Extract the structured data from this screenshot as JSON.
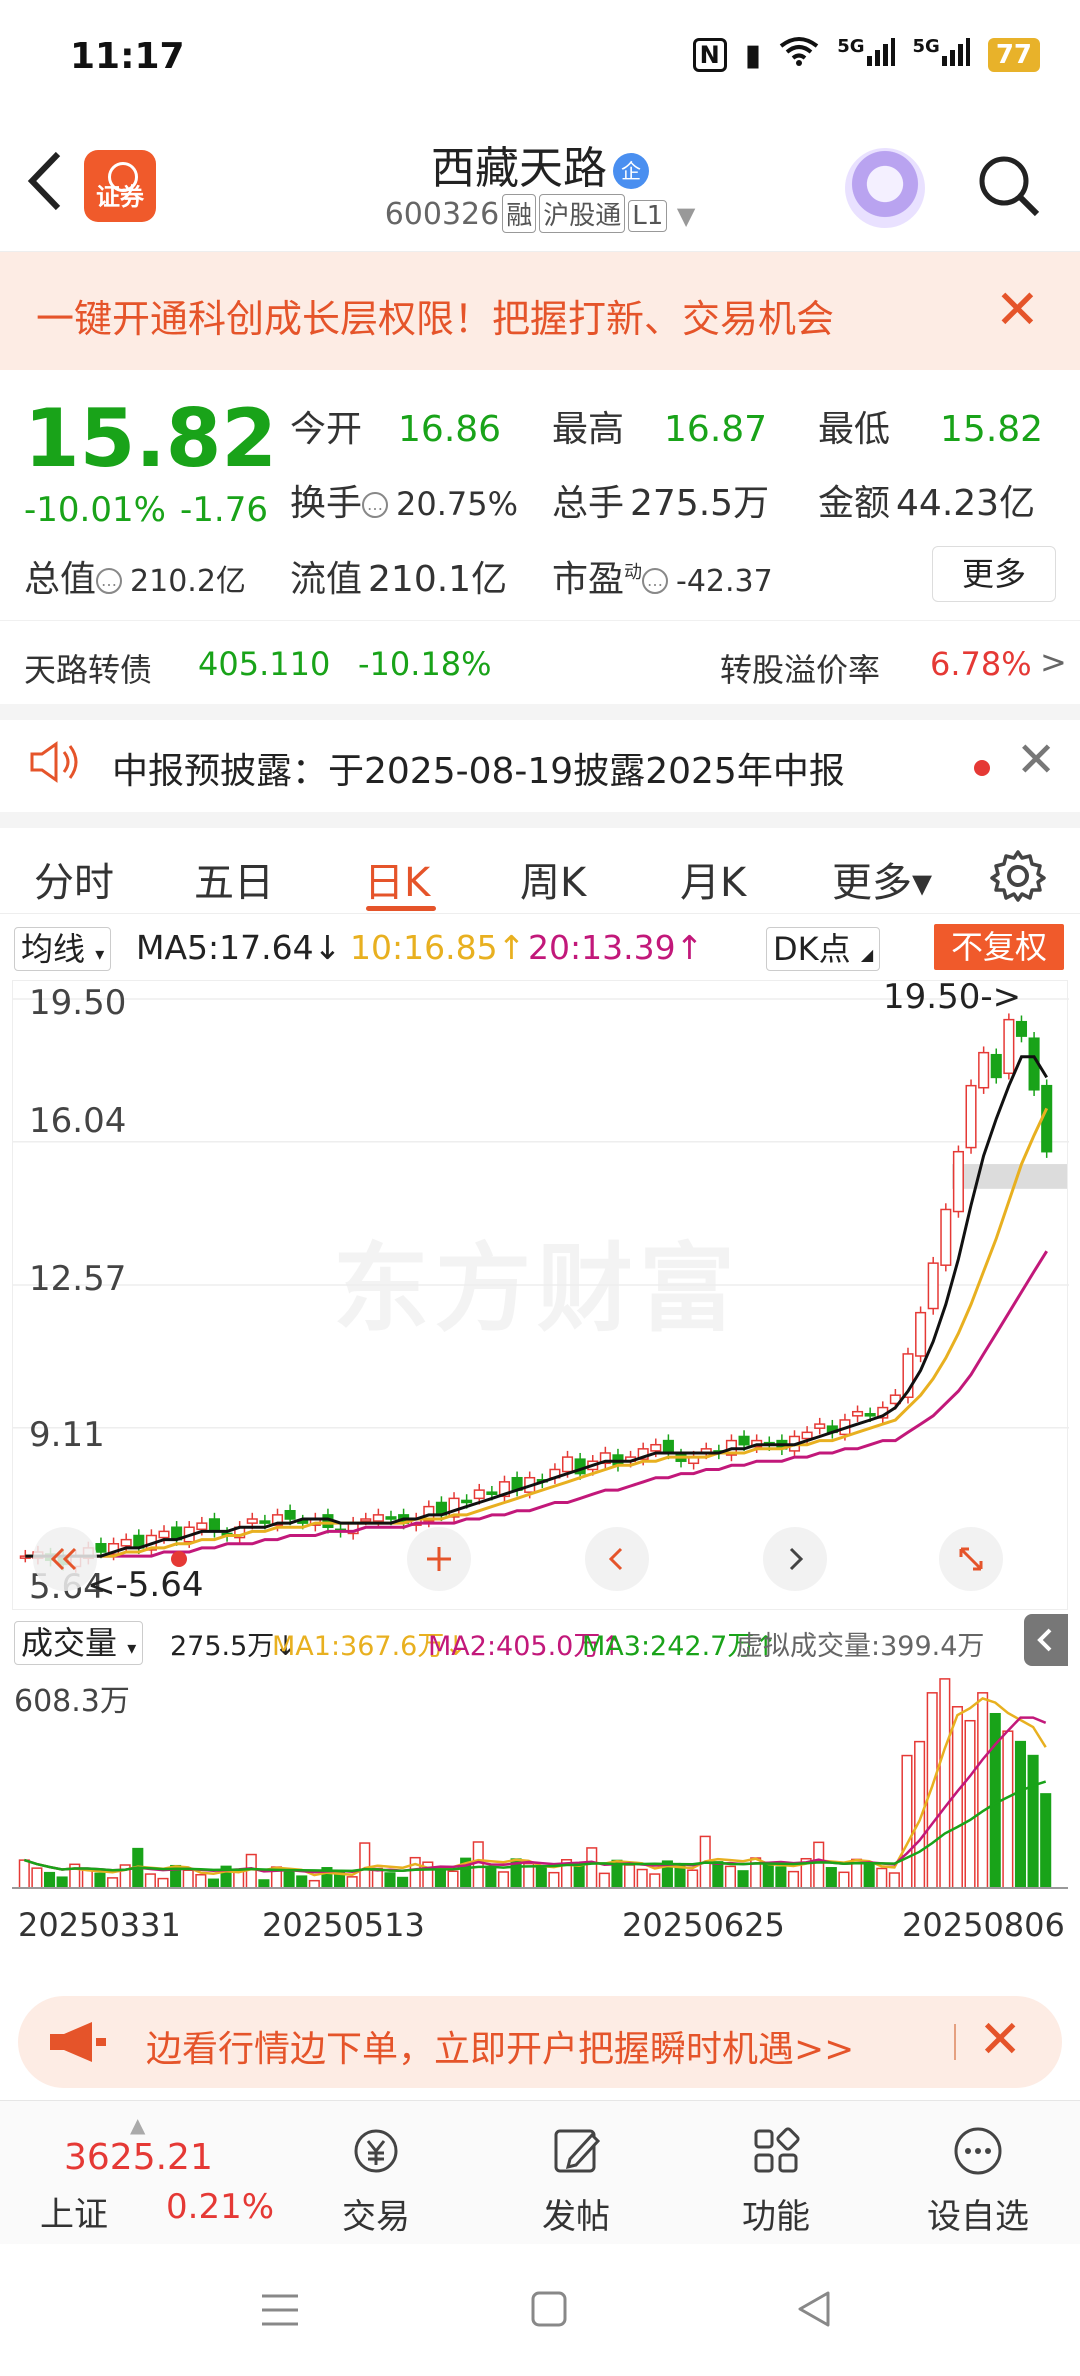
{
  "status": {
    "time": "11:17",
    "nfc": "N",
    "net1": "5G",
    "net2": "5G",
    "battery": "77"
  },
  "header": {
    "broker_label": "证券",
    "stock_name": "西藏天路",
    "badge": "企",
    "code": "600326",
    "tags": [
      "融",
      "沪股通",
      "L1"
    ]
  },
  "promo": {
    "text": "一键开通科创成长层权限！把握打新、交易机会",
    "close": "✕"
  },
  "quote": {
    "price": "15.82",
    "pct": "-10.01%",
    "chg": "-1.76",
    "open_label": "今开",
    "open": "16.86",
    "high_label": "最高",
    "high": "16.87",
    "low_label": "最低",
    "low": "15.82",
    "turnover_label": "换手",
    "turnover": "20.75%",
    "volume_label": "总手",
    "volume": "275.5万",
    "amount_label": "金额",
    "amount": "44.23亿",
    "mktcap_label": "总值",
    "mktcap": "210.2亿",
    "float_label": "流值",
    "float": "210.1亿",
    "pe_label": "市盈",
    "pe_sup": "动",
    "pe": "-42.37",
    "more": "更多"
  },
  "bond": {
    "name": "天路转债",
    "price": "405.110",
    "pct": "-10.18%",
    "premium_label": "转股溢价率",
    "premium": "6.78%",
    "arrow": ">"
  },
  "notice": {
    "text": "中报预披露：于2025-08-19披露2025年中报",
    "close": "✕"
  },
  "tabs": [
    {
      "label": "分时"
    },
    {
      "label": "五日"
    },
    {
      "label": "日K"
    },
    {
      "label": "周K"
    },
    {
      "label": "月K"
    },
    {
      "label": "更多▾"
    }
  ],
  "chart_head": {
    "indicator": "均线",
    "ma5": "MA5:17.64↓",
    "ma10": "10:16.85↑",
    "ma20": "20:13.39↑",
    "dk": "DK点",
    "fq": "不复权"
  },
  "chart_data": {
    "type": "candlestick",
    "y_ticks": [
      "19.50",
      "16.04",
      "12.57",
      "9.11",
      "5.64"
    ],
    "ylim": [
      5.64,
      19.5
    ],
    "max_label": "19.50->",
    "min_label": "<-5.64",
    "watermark": "东方财富",
    "x_labels": [
      "20250331",
      "20250513",
      "20250625",
      "20250806"
    ],
    "close": [
      6.0,
      6.1,
      5.9,
      5.8,
      6.0,
      6.2,
      6.1,
      6.3,
      6.4,
      6.2,
      6.5,
      6.6,
      6.4,
      6.7,
      6.8,
      6.6,
      6.5,
      6.7,
      6.9,
      6.8,
      7.0,
      6.9,
      6.8,
      6.9,
      6.7,
      6.6,
      6.8,
      6.9,
      7.0,
      6.9,
      6.8,
      6.9,
      7.2,
      7.0,
      7.4,
      7.3,
      7.6,
      7.5,
      7.8,
      7.6,
      7.9,
      7.8,
      8.1,
      8.4,
      8.0,
      8.3,
      8.5,
      8.2,
      8.4,
      8.6,
      8.7,
      8.5,
      8.3,
      8.4,
      8.6,
      8.5,
      8.8,
      8.7,
      8.8,
      8.7,
      8.6,
      8.9,
      9.0,
      9.2,
      9.0,
      9.3,
      9.5,
      9.4,
      9.6,
      9.9,
      10.9,
      11.9,
      13.1,
      14.4,
      15.8,
      17.4,
      18.2,
      17.6,
      19.0,
      18.6,
      17.3,
      15.8
    ],
    "ma5": [
      6.0,
      6.0,
      6.0,
      6.0,
      6.0,
      6.0,
      6.0,
      6.1,
      6.2,
      6.2,
      6.3,
      6.4,
      6.4,
      6.5,
      6.6,
      6.6,
      6.6,
      6.7,
      6.7,
      6.7,
      6.8,
      6.8,
      6.9,
      6.9,
      6.9,
      6.8,
      6.8,
      6.8,
      6.8,
      6.8,
      6.9,
      6.9,
      7.0,
      7.0,
      7.1,
      7.2,
      7.3,
      7.4,
      7.5,
      7.6,
      7.7,
      7.8,
      7.9,
      8.0,
      8.1,
      8.2,
      8.3,
      8.3,
      8.3,
      8.4,
      8.5,
      8.5,
      8.5,
      8.5,
      8.5,
      8.5,
      8.6,
      8.6,
      8.7,
      8.7,
      8.7,
      8.7,
      8.8,
      8.9,
      9.0,
      9.1,
      9.2,
      9.3,
      9.4,
      9.6,
      10.0,
      10.5,
      11.2,
      12.1,
      13.2,
      14.5,
      15.7,
      16.6,
      17.4,
      18.1,
      18.1,
      17.6
    ],
    "ma10": [
      6.0,
      6.0,
      6.0,
      6.0,
      6.0,
      6.0,
      6.0,
      6.0,
      6.1,
      6.1,
      6.2,
      6.2,
      6.3,
      6.3,
      6.4,
      6.4,
      6.5,
      6.5,
      6.6,
      6.6,
      6.7,
      6.7,
      6.7,
      6.8,
      6.8,
      6.8,
      6.8,
      6.8,
      6.8,
      6.8,
      6.8,
      6.9,
      6.9,
      6.9,
      7.0,
      7.0,
      7.1,
      7.2,
      7.3,
      7.4,
      7.5,
      7.6,
      7.7,
      7.8,
      7.9,
      8.0,
      8.1,
      8.2,
      8.2,
      8.3,
      8.3,
      8.4,
      8.4,
      8.4,
      8.4,
      8.5,
      8.5,
      8.5,
      8.6,
      8.6,
      8.6,
      8.7,
      8.7,
      8.8,
      8.8,
      8.9,
      9.0,
      9.1,
      9.2,
      9.3,
      9.6,
      9.9,
      10.3,
      10.8,
      11.4,
      12.1,
      12.9,
      13.7,
      14.6,
      15.5,
      16.2,
      16.85
    ],
    "ma20": [
      6.0,
      6.0,
      6.0,
      6.0,
      6.0,
      6.0,
      6.0,
      6.0,
      6.0,
      6.0,
      6.0,
      6.1,
      6.1,
      6.1,
      6.2,
      6.2,
      6.3,
      6.3,
      6.3,
      6.4,
      6.4,
      6.5,
      6.5,
      6.5,
      6.6,
      6.6,
      6.6,
      6.7,
      6.7,
      6.7,
      6.7,
      6.8,
      6.8,
      6.8,
      6.8,
      6.9,
      6.9,
      7.0,
      7.0,
      7.1,
      7.1,
      7.2,
      7.3,
      7.3,
      7.4,
      7.5,
      7.6,
      7.6,
      7.7,
      7.8,
      7.9,
      7.9,
      8.0,
      8.0,
      8.1,
      8.1,
      8.2,
      8.2,
      8.3,
      8.3,
      8.3,
      8.4,
      8.4,
      8.5,
      8.5,
      8.6,
      8.6,
      8.7,
      8.8,
      8.8,
      9.0,
      9.2,
      9.4,
      9.7,
      10.0,
      10.4,
      10.9,
      11.4,
      11.9,
      12.4,
      12.9,
      13.39
    ]
  },
  "vol_head": {
    "label": "成交量",
    "vol": "275.5万↓",
    "ma1": "MA1:367.6万↓",
    "ma2": "MA2:405.0万↑",
    "ma3": "MA3:242.7万↑",
    "virtual": "虚拟成交量:399.4万",
    "max": "608.3万"
  },
  "ad": {
    "text": "边看行情边下单，立即开户把握瞬时机遇>>",
    "close": "✕"
  },
  "bottom": {
    "index_value": "3625.21",
    "index_name": "上证",
    "index_chg": "0.21%",
    "nav": [
      {
        "label": "交易"
      },
      {
        "label": "发帖"
      },
      {
        "label": "功能"
      },
      {
        "label": "设自选"
      }
    ]
  },
  "colors": {
    "up": "#e53935",
    "down": "#19a319",
    "accent": "#e5542a",
    "ma5": "#111111",
    "ma10": "#e8b020",
    "ma20": "#c2187a"
  }
}
